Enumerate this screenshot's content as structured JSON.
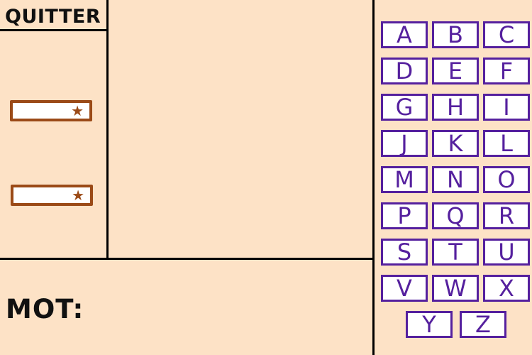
{
  "header": {
    "quit_label": "QUITTER"
  },
  "left_panel": {
    "slots": [
      {
        "icon": "star-icon"
      },
      {
        "icon": "star-icon"
      }
    ]
  },
  "word_panel": {
    "label": "MOT:"
  },
  "keyboard": {
    "letters": [
      "A",
      "B",
      "C",
      "D",
      "E",
      "F",
      "G",
      "H",
      "I",
      "J",
      "K",
      "L",
      "M",
      "N",
      "O",
      "P",
      "Q",
      "R",
      "S",
      "T",
      "U",
      "V",
      "W",
      "X",
      "Y",
      "Z"
    ]
  },
  "colors": {
    "background": "#fde2c6",
    "key_accent": "#55209e",
    "slot_accent": "#9b4a17"
  }
}
